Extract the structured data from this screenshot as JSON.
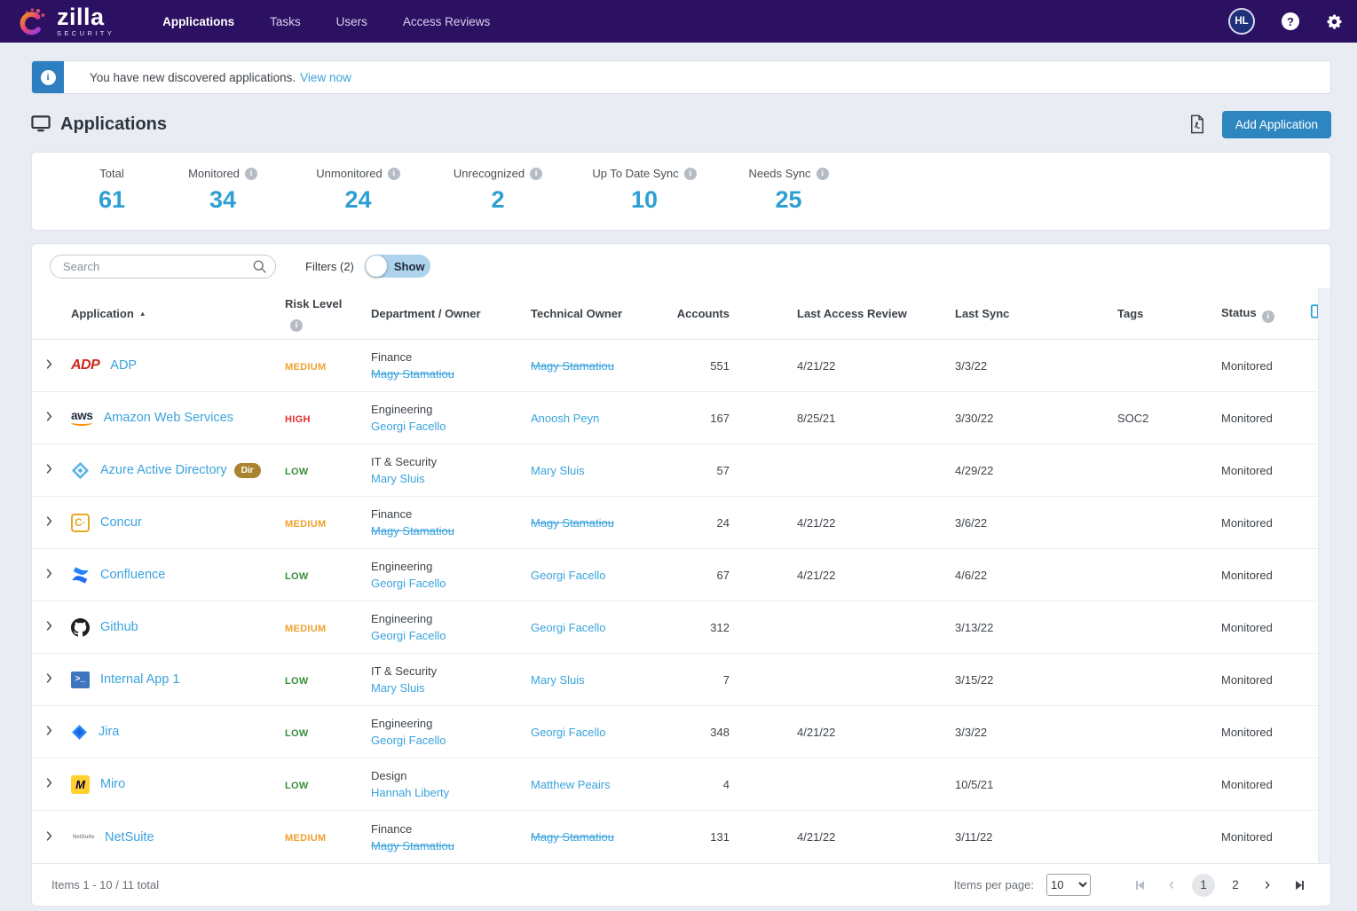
{
  "nav": {
    "brand": {
      "name": "zilla",
      "sub": "SECURITY"
    },
    "items": [
      {
        "label": "Applications",
        "active": true
      },
      {
        "label": "Tasks",
        "active": false
      },
      {
        "label": "Users",
        "active": false
      },
      {
        "label": "Access Reviews",
        "active": false
      }
    ],
    "avatar_initials": "HL"
  },
  "banner": {
    "text": "You have new discovered applications.",
    "link_label": "View now"
  },
  "header": {
    "title": "Applications",
    "add_button_label": "Add Application"
  },
  "stats": [
    {
      "label": "Total",
      "value": "61"
    },
    {
      "label": "Monitored",
      "value": "34"
    },
    {
      "label": "Unmonitored",
      "value": "24"
    },
    {
      "label": "Unrecognized",
      "value": "2"
    },
    {
      "label": "Up To Date Sync",
      "value": "10"
    },
    {
      "label": "Needs Sync",
      "value": "25"
    }
  ],
  "toolbar": {
    "search_placeholder": "Search",
    "filters_label": "Filters (2)",
    "toggle_label": "Show"
  },
  "table": {
    "columns": [
      "Application",
      "Risk Level",
      "Department / Owner",
      "Technical Owner",
      "Accounts",
      "Last Access Review",
      "Last Sync",
      "Tags",
      "Status"
    ],
    "rows": [
      {
        "name": "ADP",
        "icon": "adp",
        "badge": "",
        "risk": "MEDIUM",
        "department": "Finance",
        "dept_owner": "Magy Stamatiou",
        "dept_owner_struck": true,
        "tech_owner": "Magy Stamatiou",
        "tech_owner_struck": true,
        "accounts": "551",
        "last_access_review": "4/21/22",
        "last_sync": "3/3/22",
        "tags": "",
        "status": "Monitored"
      },
      {
        "name": "Amazon Web Services",
        "icon": "aws",
        "badge": "",
        "risk": "HIGH",
        "department": "Engineering",
        "dept_owner": "Georgi Facello",
        "dept_owner_struck": false,
        "tech_owner": "Anoosh Peyn",
        "tech_owner_struck": false,
        "accounts": "167",
        "last_access_review": "8/25/21",
        "last_sync": "3/30/22",
        "tags": "SOC2",
        "status": "Monitored"
      },
      {
        "name": "Azure Active Directory",
        "icon": "azure",
        "badge": "Dir",
        "risk": "LOW",
        "department": "IT & Security",
        "dept_owner": "Mary Sluis",
        "dept_owner_struck": false,
        "tech_owner": "Mary Sluis",
        "tech_owner_struck": false,
        "accounts": "57",
        "last_access_review": "",
        "last_sync": "4/29/22",
        "tags": "",
        "status": "Monitored"
      },
      {
        "name": "Concur",
        "icon": "concur",
        "badge": "",
        "risk": "MEDIUM",
        "department": "Finance",
        "dept_owner": "Magy Stamatiou",
        "dept_owner_struck": true,
        "tech_owner": "Magy Stamatiou",
        "tech_owner_struck": true,
        "accounts": "24",
        "last_access_review": "4/21/22",
        "last_sync": "3/6/22",
        "tags": "",
        "status": "Monitored"
      },
      {
        "name": "Confluence",
        "icon": "confluence",
        "badge": "",
        "risk": "LOW",
        "department": "Engineering",
        "dept_owner": "Georgi Facello",
        "dept_owner_struck": false,
        "tech_owner": "Georgi Facello",
        "tech_owner_struck": false,
        "accounts": "67",
        "last_access_review": "4/21/22",
        "last_sync": "4/6/22",
        "tags": "",
        "status": "Monitored"
      },
      {
        "name": "Github",
        "icon": "github",
        "badge": "",
        "risk": "MEDIUM",
        "department": "Engineering",
        "dept_owner": "Georgi Facello",
        "dept_owner_struck": false,
        "tech_owner": "Georgi Facello",
        "tech_owner_struck": false,
        "accounts": "312",
        "last_access_review": "",
        "last_sync": "3/13/22",
        "tags": "",
        "status": "Monitored"
      },
      {
        "name": "Internal App 1",
        "icon": "internal",
        "badge": "",
        "risk": "LOW",
        "department": "IT & Security",
        "dept_owner": "Mary Sluis",
        "dept_owner_struck": false,
        "tech_owner": "Mary Sluis",
        "tech_owner_struck": false,
        "accounts": "7",
        "last_access_review": "",
        "last_sync": "3/15/22",
        "tags": "",
        "status": "Monitored"
      },
      {
        "name": "Jira",
        "icon": "jira",
        "badge": "",
        "risk": "LOW",
        "department": "Engineering",
        "dept_owner": "Georgi Facello",
        "dept_owner_struck": false,
        "tech_owner": "Georgi Facello",
        "tech_owner_struck": false,
        "accounts": "348",
        "last_access_review": "4/21/22",
        "last_sync": "3/3/22",
        "tags": "",
        "status": "Monitored"
      },
      {
        "name": "Miro",
        "icon": "miro",
        "badge": "",
        "risk": "LOW",
        "department": "Design",
        "dept_owner": "Hannah Liberty",
        "dept_owner_struck": false,
        "tech_owner": "Matthew Peairs",
        "tech_owner_struck": false,
        "accounts": "4",
        "last_access_review": "",
        "last_sync": "10/5/21",
        "tags": "",
        "status": "Monitored"
      },
      {
        "name": "NetSuite",
        "icon": "netsuite",
        "badge": "",
        "risk": "MEDIUM",
        "department": "Finance",
        "dept_owner": "Magy Stamatiou",
        "dept_owner_struck": true,
        "tech_owner": "Magy Stamatiou",
        "tech_owner_struck": true,
        "accounts": "131",
        "last_access_review": "4/21/22",
        "last_sync": "3/11/22",
        "tags": "",
        "status": "Monitored"
      }
    ]
  },
  "footer": {
    "items_text": "Items 1 - 10 / 11 total",
    "per_page_label": "Items per page:",
    "per_page_value": "10",
    "pages": [
      "1",
      "2"
    ],
    "current_page": "1"
  },
  "colors": {
    "nav_bg": "#2c1061",
    "link_blue": "#3aa3dc",
    "stat_blue": "#2e9fd4",
    "button_blue": "#2e86c1",
    "risk": {
      "HIGH": "#e32f2b",
      "MEDIUM": "#f0a030",
      "LOW": "#388e3c"
    }
  }
}
